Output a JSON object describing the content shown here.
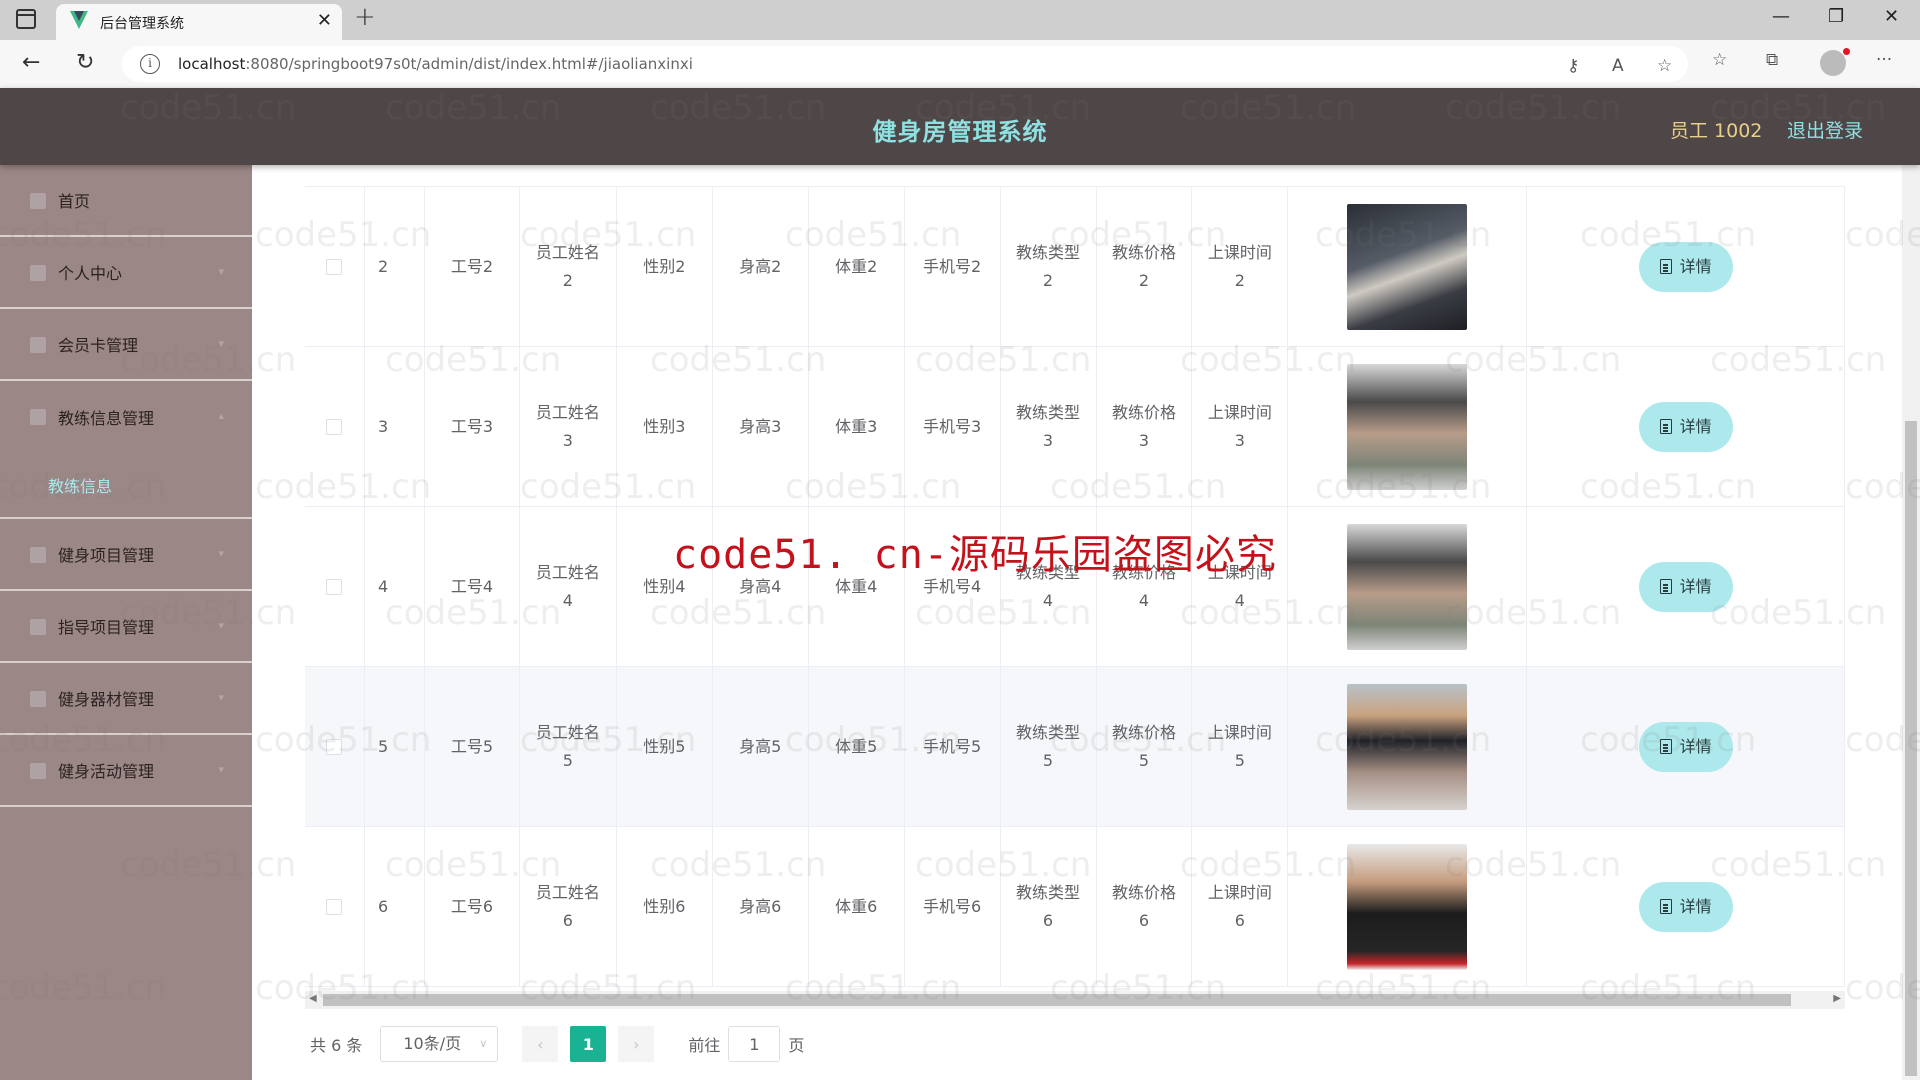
{
  "browser": {
    "tab_title": "后台管理系统",
    "url_host": "localhost",
    "url_rest": ":8080/springboot97s0t/admin/dist/index.html#/jiaolianxinxi",
    "icons": [
      "sidebar-toggle-icon",
      "vue-logo-icon",
      "close-icon",
      "plus-icon",
      "back-icon",
      "refresh-icon",
      "info-icon",
      "key-icon",
      "read-aloud-icon",
      "add-favorite-icon",
      "favorites-icon",
      "collections-icon",
      "profile-icon",
      "more-icon",
      "minimize-icon",
      "restore-icon",
      "window-close-icon"
    ]
  },
  "header": {
    "title": "健身房管理系统",
    "user": "员工 1002",
    "logout": "退出登录"
  },
  "sidebar": {
    "items": [
      {
        "label": "首页",
        "icon": "home-icon"
      },
      {
        "label": "个人中心",
        "icon": "user-icon"
      },
      {
        "label": "会员卡管理",
        "icon": "card-icon"
      },
      {
        "label": "教练信息管理",
        "icon": "folder-icon",
        "children": [
          {
            "label": "教练信息",
            "active": true
          }
        ]
      },
      {
        "label": "健身项目管理",
        "icon": "project-icon"
      },
      {
        "label": "指导项目管理",
        "icon": "chart-icon"
      },
      {
        "label": "健身器材管理",
        "icon": "equipment-icon"
      },
      {
        "label": "健身活动管理",
        "icon": "activity-icon"
      }
    ]
  },
  "table": {
    "rows": [
      {
        "index": "2",
        "job_no": "工号2",
        "name": "员工姓名2",
        "sex": "性别2",
        "height": "身高2",
        "weight": "体重2",
        "phone": "手机号2",
        "type": "教练类型2",
        "price": "教练价格2",
        "time": "上课时间2",
        "photo": "coach photo 2",
        "action": "详情"
      },
      {
        "index": "3",
        "job_no": "工号3",
        "name": "员工姓名3",
        "sex": "性别3",
        "height": "身高3",
        "weight": "体重3",
        "phone": "手机号3",
        "type": "教练类型3",
        "price": "教练价格3",
        "time": "上课时间3",
        "photo": "coach photo 3",
        "action": "详情"
      },
      {
        "index": "4",
        "job_no": "工号4",
        "name": "员工姓名4",
        "sex": "性别4",
        "height": "身高4",
        "weight": "体重4",
        "phone": "手机号4",
        "type": "教练类型4",
        "price": "教练价格4",
        "time": "上课时间4",
        "photo": "coach photo 4",
        "action": "详情"
      },
      {
        "index": "5",
        "job_no": "工号5",
        "name": "员工姓名5",
        "sex": "性别5",
        "height": "身高5",
        "weight": "体重5",
        "phone": "手机号5",
        "type": "教练类型5",
        "price": "教练价格5",
        "time": "上课时间5",
        "photo": "coach photo 5",
        "action": "详情",
        "hovered": true
      },
      {
        "index": "6",
        "job_no": "工号6",
        "name": "员工姓名6",
        "sex": "性别6",
        "height": "身高6",
        "weight": "体重6",
        "phone": "手机号6",
        "type": "教练类型6",
        "price": "教练价格6",
        "time": "上课时间6",
        "photo": "coach photo 6",
        "action": "详情"
      }
    ]
  },
  "pagination": {
    "total": "共 6 条",
    "page_size": "10条/页",
    "current_page": "1",
    "goto_label": "前往",
    "goto_value": "1",
    "page_suffix": "页"
  },
  "watermark": {
    "small": "code51.cn",
    "big": "code51. cn-源码乐园盗图必究"
  },
  "colors": {
    "header_bg": "#4f4647",
    "sidebar_bg": "#9b8785",
    "accent": "#8fe0e0",
    "user_label": "#e8d08a",
    "detail_button": "#ade9ec",
    "pager_active": "#19b393",
    "watermark_big": "#c3121b"
  }
}
